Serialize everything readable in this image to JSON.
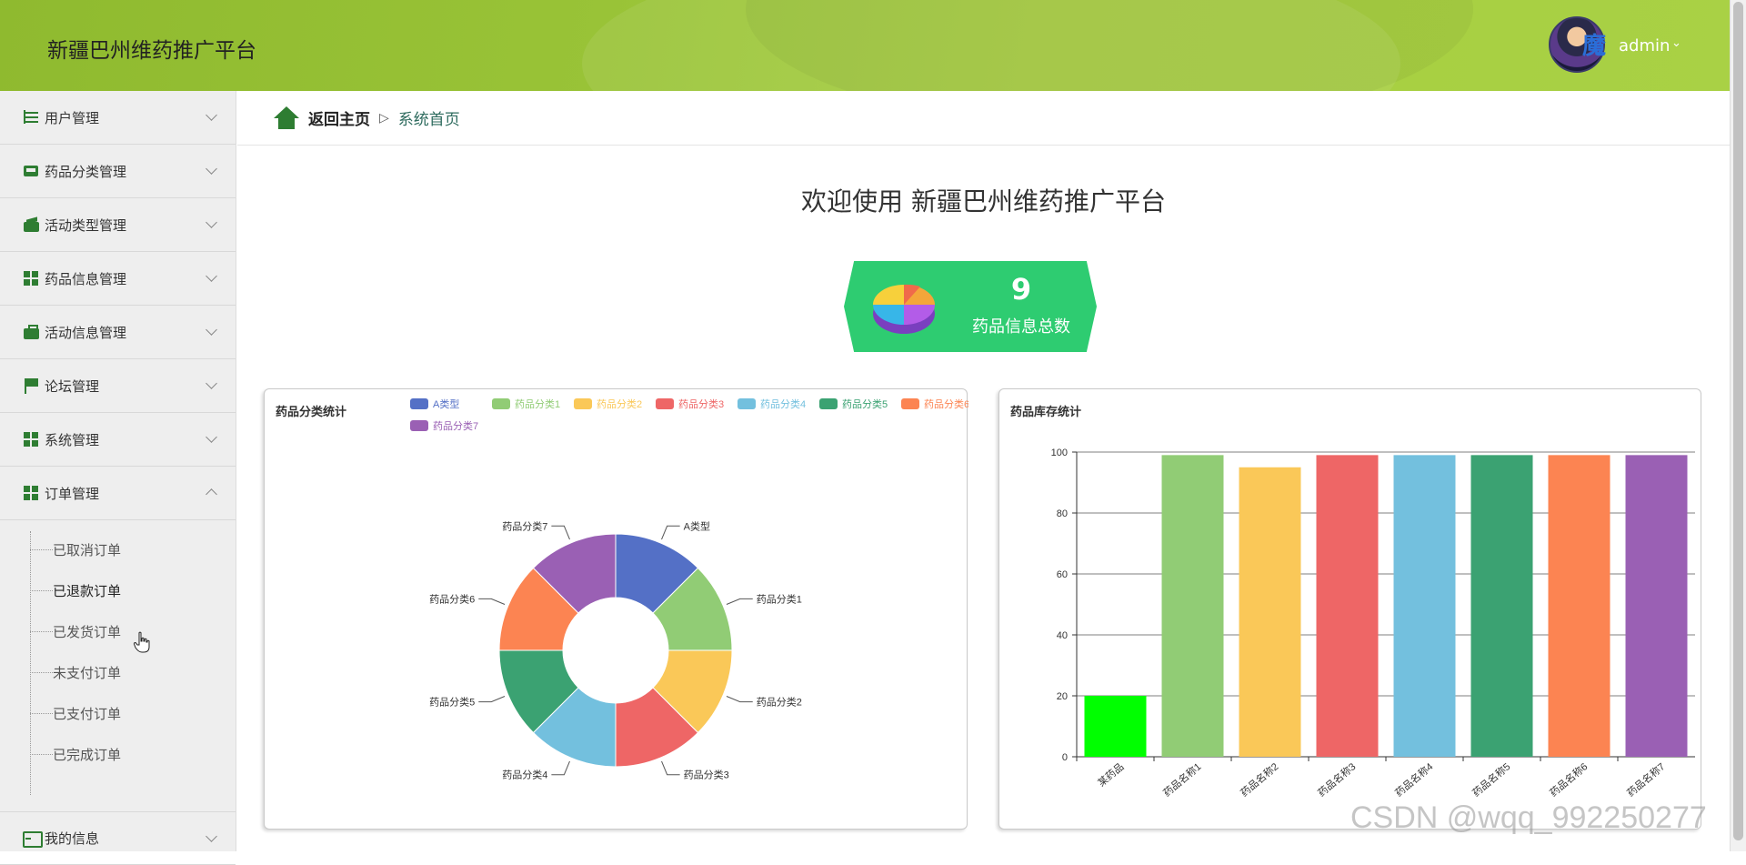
{
  "header": {
    "title": "新疆巴州维药推广平台",
    "user": "admin",
    "avatar_char": "魔"
  },
  "sidebar": {
    "items": [
      {
        "label": "用户管理",
        "icon": "list-icon"
      },
      {
        "label": "药品分类管理",
        "icon": "tray-icon"
      },
      {
        "label": "活动类型管理",
        "icon": "wallet-icon"
      },
      {
        "label": "药品信息管理",
        "icon": "grid-icon"
      },
      {
        "label": "活动信息管理",
        "icon": "briefcase-icon"
      },
      {
        "label": "论坛管理",
        "icon": "flag-icon"
      },
      {
        "label": "系统管理",
        "icon": "grid-icon"
      },
      {
        "label": "订单管理",
        "icon": "grid-icon",
        "expanded": true
      }
    ],
    "order_submenu": [
      "已取消订单",
      "已退款订单",
      "已发货订单",
      "未支付订单",
      "已支付订单",
      "已完成订单"
    ],
    "bottom_item": {
      "label": "我的信息",
      "icon": "card-icon"
    }
  },
  "breadcrumb": {
    "home": "返回主页",
    "separator": "▷",
    "current": "系统首页"
  },
  "welcome": "欢迎使用 新疆巴州维药推广平台",
  "stat": {
    "value": "9",
    "label": "药品信息总数",
    "color": "#2ecc71"
  },
  "watermark": "CSDN @wqq_992250277",
  "chart_data": [
    {
      "type": "pie",
      "title": "药品分类统计",
      "donut": true,
      "legend_position": "top",
      "categories": [
        "A类型",
        "药品分类1",
        "药品分类2",
        "药品分类3",
        "药品分类4",
        "药品分类5",
        "药品分类6",
        "药品分类7"
      ],
      "values": [
        1,
        1,
        1,
        1,
        1,
        1,
        1,
        1
      ],
      "colors": [
        "#5470c6",
        "#91cc75",
        "#fac858",
        "#ee6666",
        "#73c0de",
        "#3ba272",
        "#fc8452",
        "#9a60b4"
      ]
    },
    {
      "type": "bar",
      "title": "药品库存统计",
      "categories": [
        "某药品",
        "药品名称1",
        "药品名称2",
        "药品名称3",
        "药品名称4",
        "药品名称5",
        "药品名称6",
        "药品名称7"
      ],
      "values": [
        20,
        99,
        95,
        99,
        99,
        99,
        99,
        99
      ],
      "ylim": [
        0,
        100
      ],
      "yticks": [
        0,
        20,
        40,
        60,
        80,
        100
      ],
      "grid": true,
      "colors": [
        "#00ff00",
        "#91cc75",
        "#fac858",
        "#ee6666",
        "#73c0de",
        "#3ba272",
        "#fc8452",
        "#9a60b4"
      ]
    }
  ]
}
